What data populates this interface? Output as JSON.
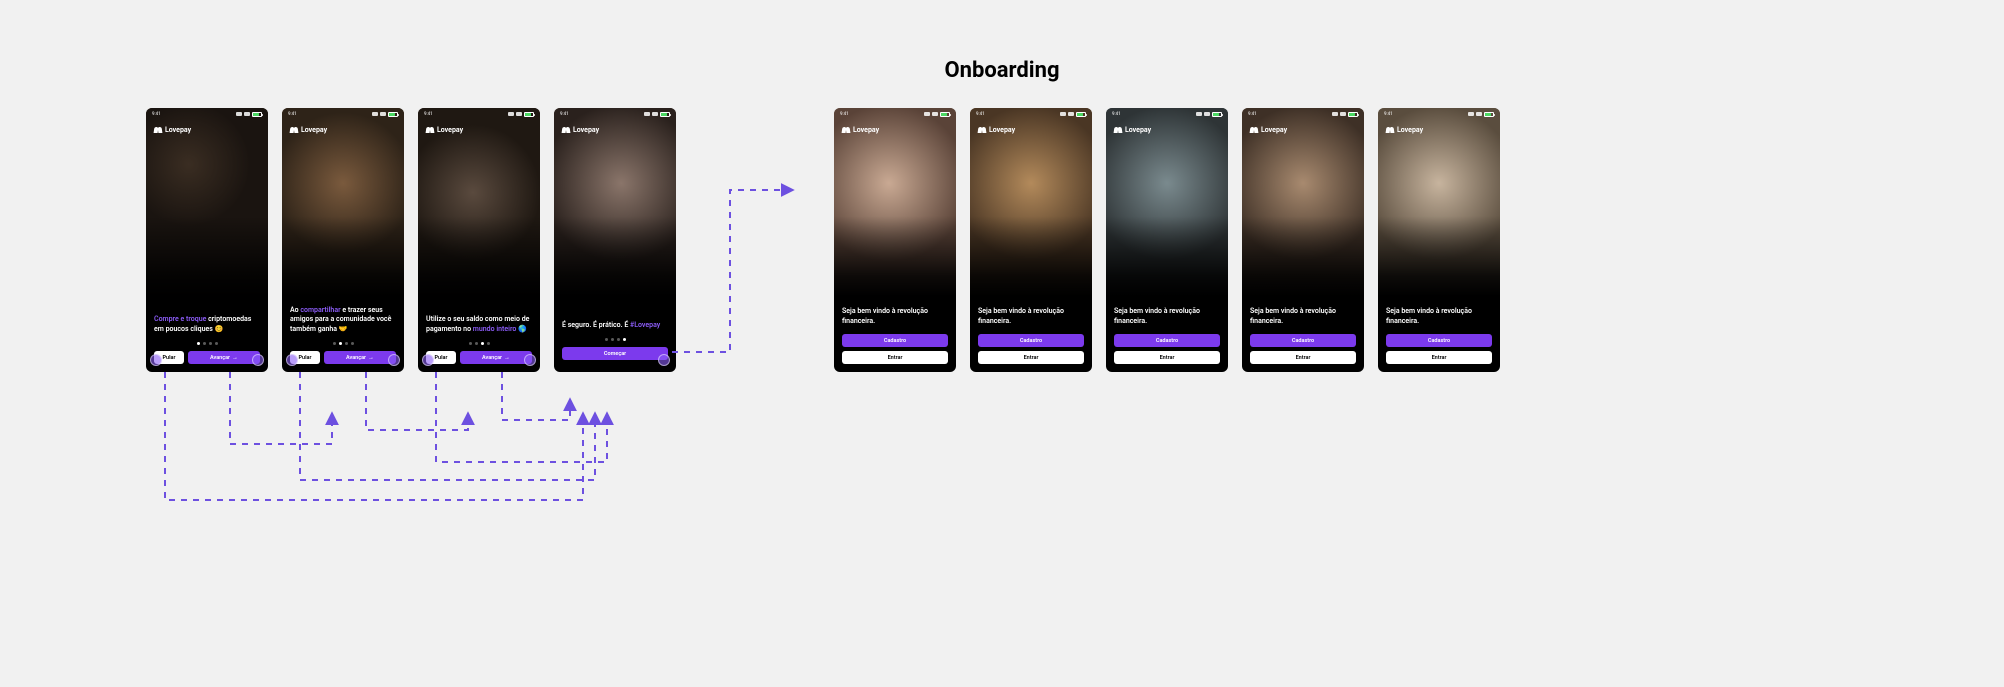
{
  "title": "Onboarding",
  "brand": "Lovepay",
  "status": {
    "time": "9:41",
    "battery_pct": 70
  },
  "colors": {
    "accent": "#7c3aed",
    "accent_light": "#8b5cf6"
  },
  "buttons": {
    "skip": "Pular",
    "advance": "Avançar",
    "begin": "Começar",
    "signup": "Cadastro",
    "login": "Entrar"
  },
  "intro_screens": [
    {
      "active_dot": 0,
      "parts": [
        {
          "text": "Compre e troque",
          "accent": true
        },
        {
          "text": " criptomoedas em poucos cliques 😊",
          "accent": false
        }
      ]
    },
    {
      "active_dot": 1,
      "parts": [
        {
          "text": "Ao ",
          "accent": false
        },
        {
          "text": "compartilhar",
          "accent": true
        },
        {
          "text": " e trazer seus amigos para a comunidade você também ganha 🤝",
          "accent": false
        }
      ]
    },
    {
      "active_dot": 2,
      "parts": [
        {
          "text": "Utilize o seu saldo como meio de pagamento no ",
          "accent": false
        },
        {
          "text": "mundo inteiro",
          "accent": true
        },
        {
          "text": " 🌎",
          "accent": false
        }
      ]
    },
    {
      "active_dot": 3,
      "parts": [
        {
          "text": "É seguro. É prático.\nÉ ",
          "accent": false
        },
        {
          "text": "#Lovepay",
          "accent": true
        }
      ]
    }
  ],
  "welcome_text": "Seja bem vindo à revolução financeira.",
  "welcome_count": 5
}
